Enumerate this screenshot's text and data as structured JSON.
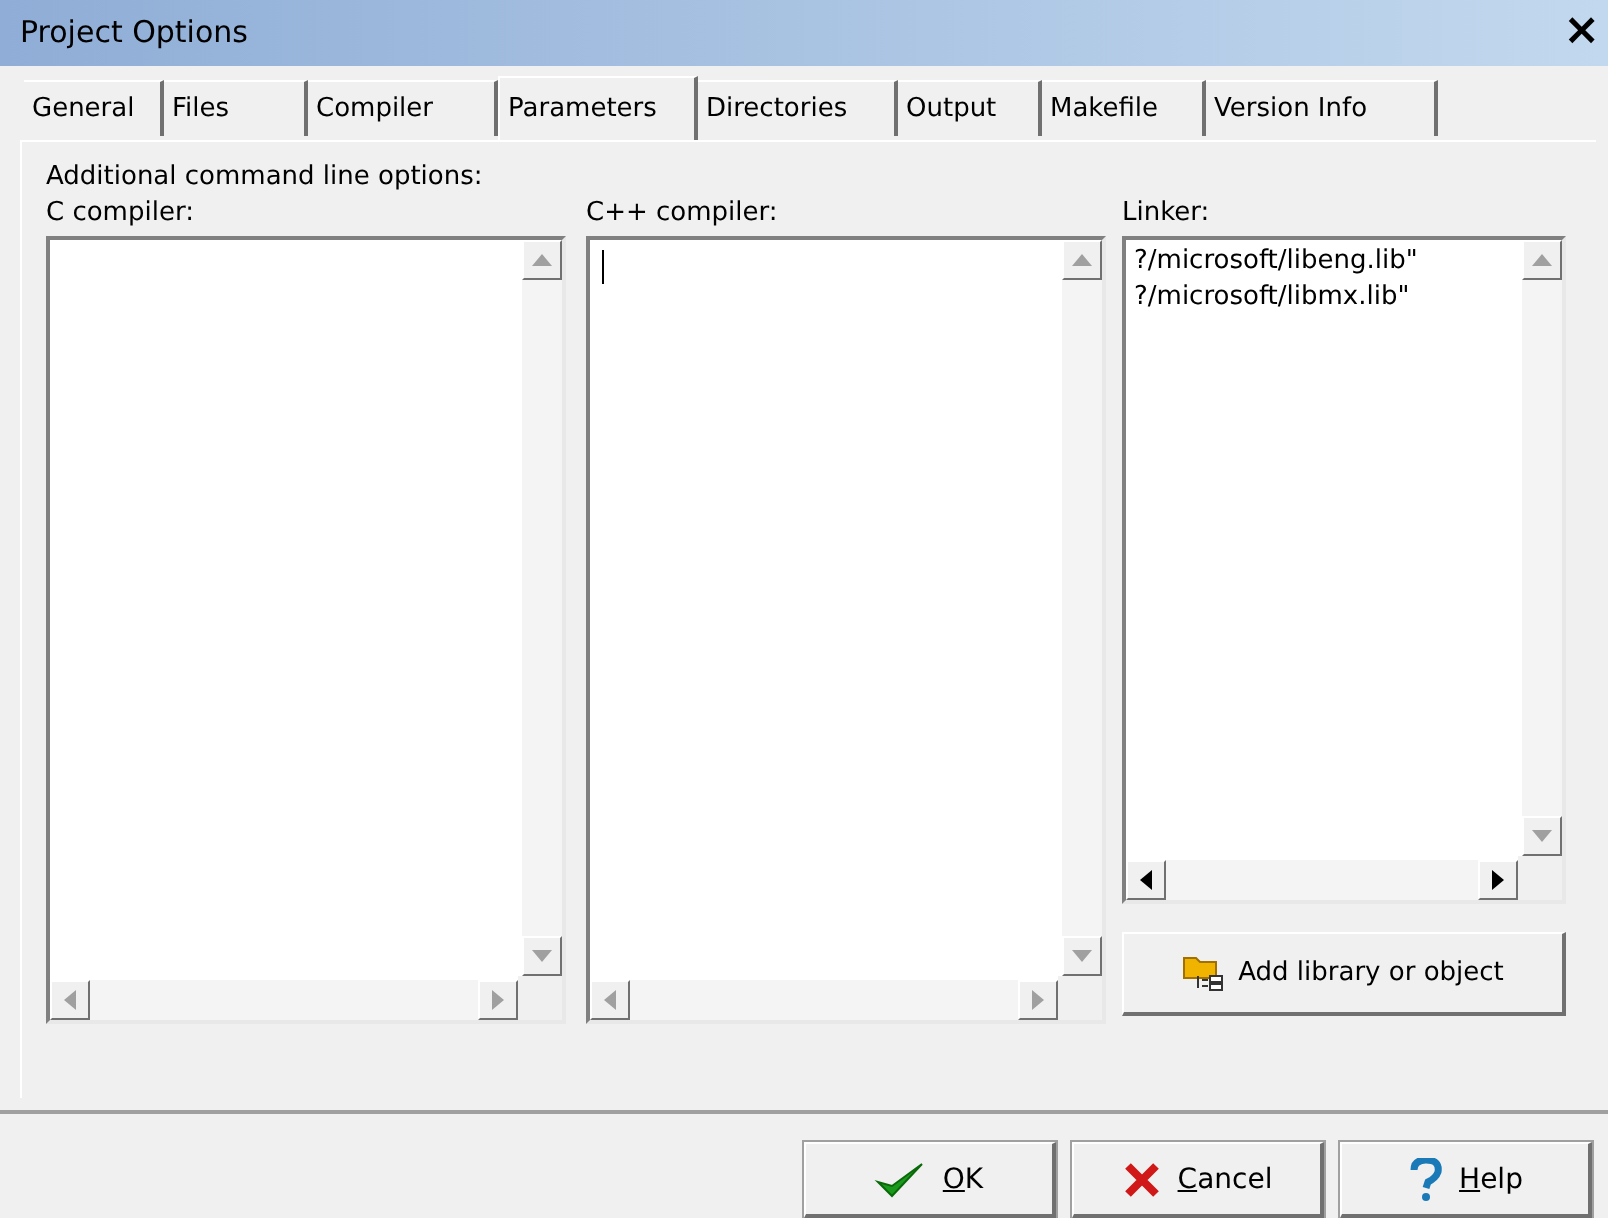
{
  "window": {
    "title": "Project Options",
    "close": "×"
  },
  "tabs": [
    {
      "label": "General",
      "selected": false
    },
    {
      "label": "Files",
      "selected": false
    },
    {
      "label": "Compiler",
      "selected": false
    },
    {
      "label": "Parameters",
      "selected": true
    },
    {
      "label": "Directories",
      "selected": false
    },
    {
      "label": "Output",
      "selected": false
    },
    {
      "label": "Makefile",
      "selected": false
    },
    {
      "label": "Version Info",
      "selected": false
    }
  ],
  "heading": "Additional command line options:",
  "memos": [
    {
      "label": "C compiler:",
      "scrollable": false
    },
    {
      "label": "C++ compiler:",
      "focused": true,
      "scrollable": false
    },
    {
      "label": "Linker:",
      "lines": [
        "?/microsoft/libeng.lib\"",
        "?/microsoft/libmx.lib\""
      ],
      "scrollable": true
    }
  ],
  "add_button": "Add library or object",
  "buttons": [
    {
      "kind": "ok",
      "key": "O",
      "rest": "K"
    },
    {
      "kind": "cancel",
      "key": "C",
      "rest": "ancel"
    },
    {
      "kind": "help",
      "key": "H",
      "rest": "elp"
    }
  ]
}
